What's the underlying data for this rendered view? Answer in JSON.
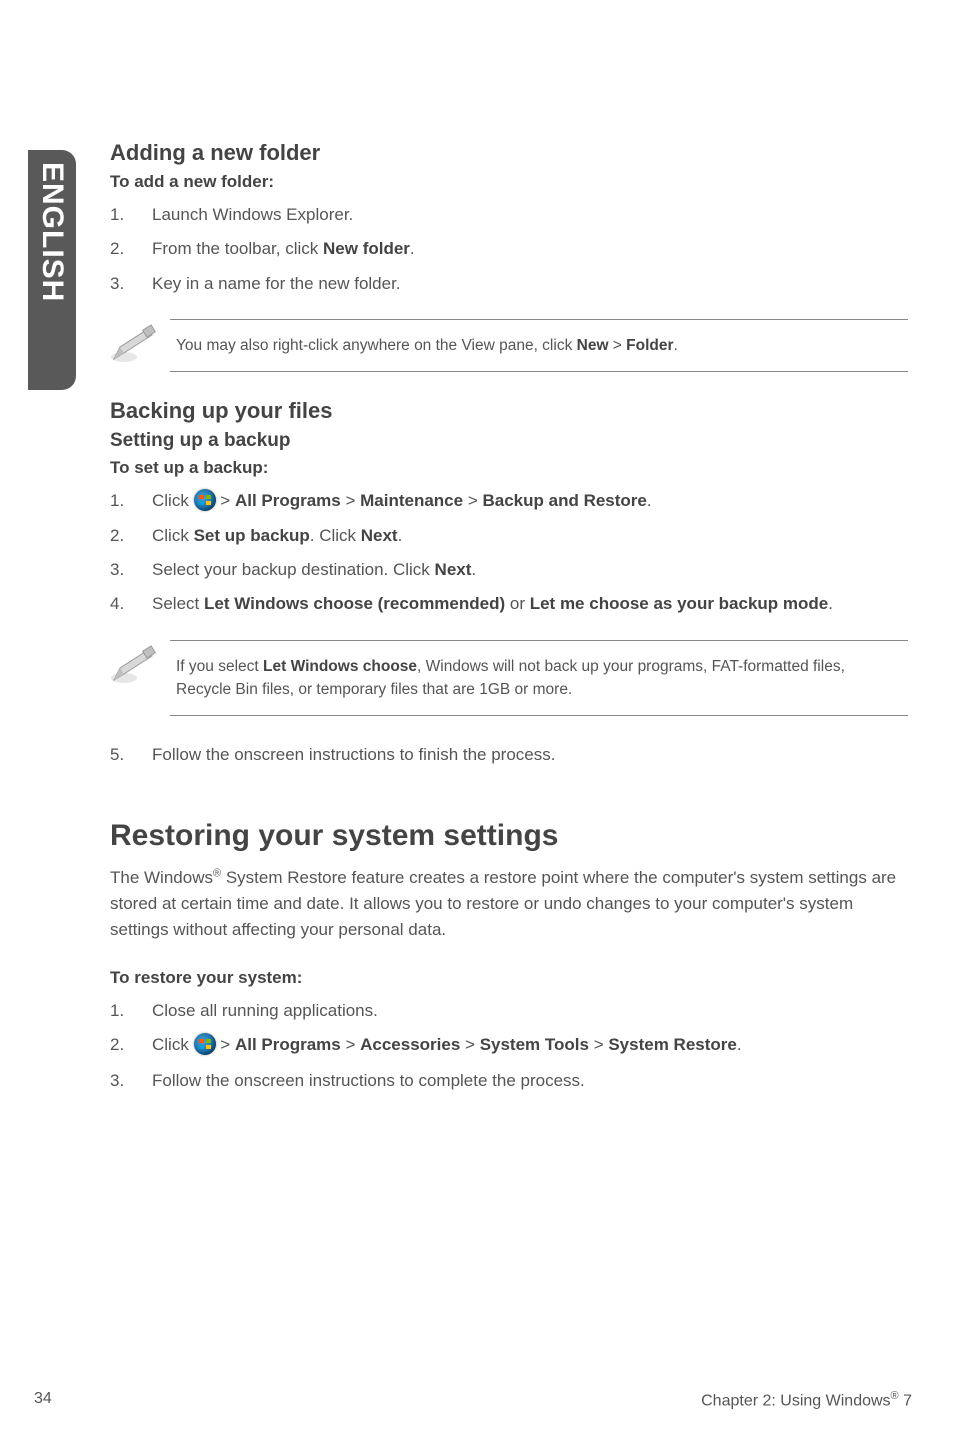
{
  "sideTab": "ENGLISH",
  "section1": {
    "title": "Adding a new folder",
    "lead": "To add a new folder:",
    "items": [
      {
        "n": "1.",
        "t": "Launch Windows Explorer."
      },
      {
        "n": "2.",
        "t": "From the toolbar, click <b>New folder</b>."
      },
      {
        "n": "3.",
        "t": "Key in a name for the new folder."
      }
    ],
    "note": "You may also right-click anywhere on the View pane, click <b>New</b> > <b>Folder</b>."
  },
  "section2": {
    "title": "Backing up your files",
    "sub": "Setting up a backup",
    "lead": "To set up a backup:",
    "items": [
      {
        "n": "1.",
        "t": "Click {WIN} > <b>All Programs</b> > <b>Maintenance</b> > <b>Backup and Restore</b>."
      },
      {
        "n": "2.",
        "t": "Click <b>Set up backup</b>. Click <b>Next</b>."
      },
      {
        "n": "3.",
        "t": "Select your backup destination. Click <b>Next</b>."
      },
      {
        "n": "4.",
        "t": "Select <b>Let Windows choose (recommended)</b> or <b>Let me choose as your backup mode</b>."
      }
    ],
    "note": "If you select <b>Let Windows choose</b>, Windows will not back up your programs, FAT-formatted files, Recycle Bin files, or temporary files that are 1GB or more.",
    "after": [
      {
        "n": "5.",
        "t": "Follow the onscreen instructions to finish the process."
      }
    ]
  },
  "section3": {
    "title": "Restoring your system settings",
    "para": "The Windows<span class=\"sup\">®</span> System Restore feature creates a restore point where the computer's system settings are stored at certain time and date. It allows you to restore or undo changes to your computer's system settings without affecting your personal data.",
    "lead": "To restore your system:",
    "items": [
      {
        "n": "1.",
        "t": "Close all running applications."
      },
      {
        "n": "2.",
        "t": "Click {WIN} > <b>All Programs</b> > <b>Accessories</b> > <b>System Tools</b> > <b>System Restore</b>."
      },
      {
        "n": "3.",
        "t": "Follow the onscreen instructions to complete the process."
      }
    ]
  },
  "footer": {
    "page": "34",
    "chapter": "Chapter 2: Using Windows<span class=\"sup\">®</span> 7"
  }
}
